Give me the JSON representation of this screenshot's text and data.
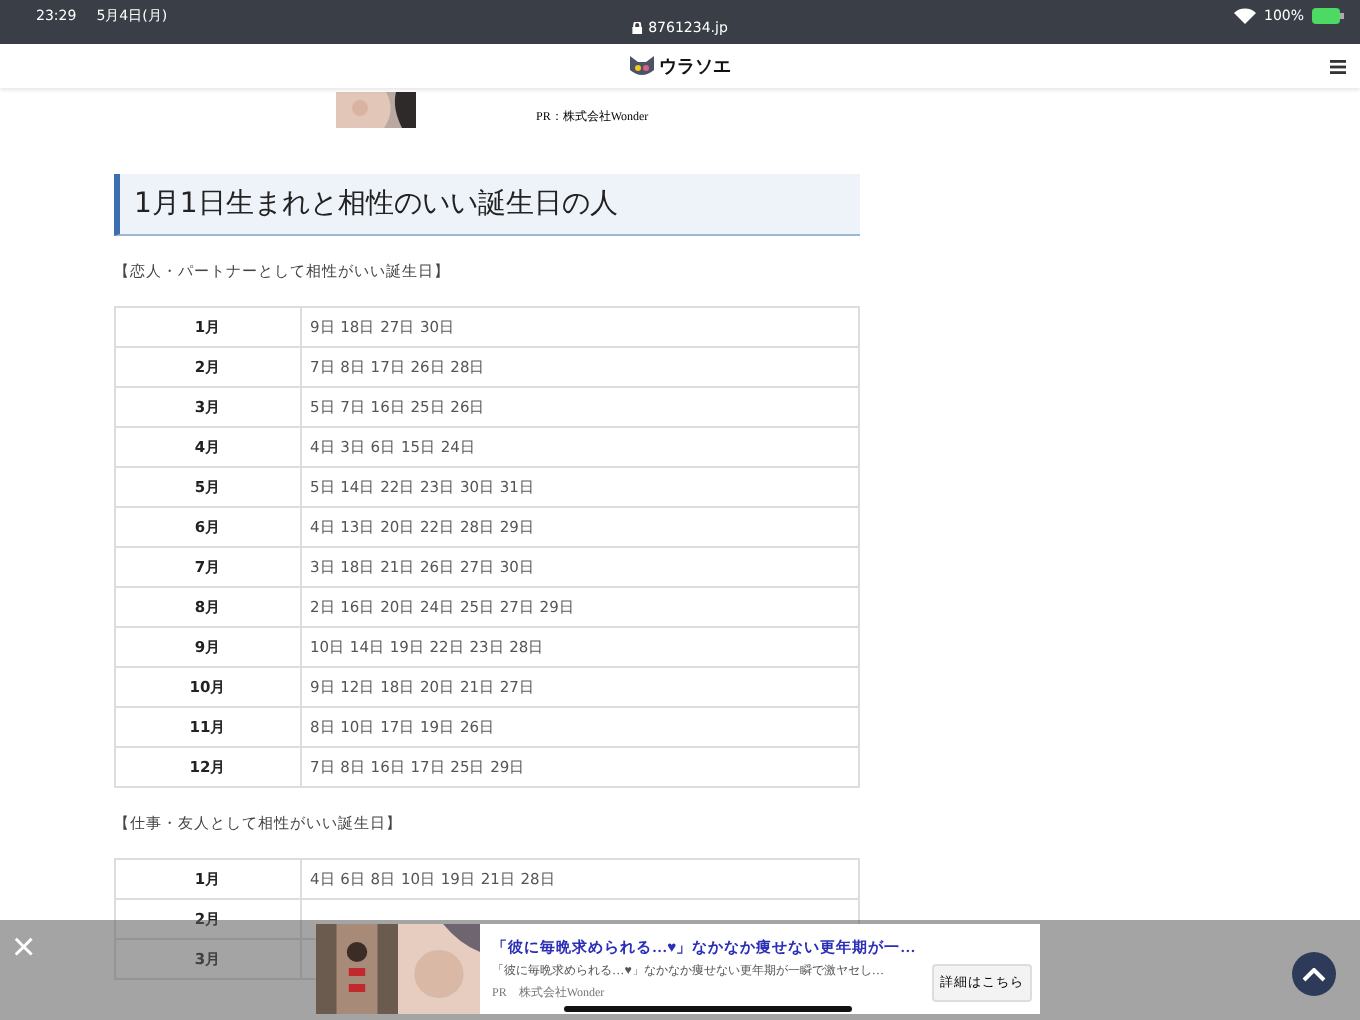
{
  "status_bar": {
    "time": "23:29",
    "date": "5月4日(月)",
    "battery": "100%"
  },
  "address_bar": {
    "url": "8761234.jp"
  },
  "site_header": {
    "logo_text": "ウラソエ"
  },
  "top_ad": {
    "advertiser": "PR：株式会社Wonder"
  },
  "heading": "1月1日生まれと相性のいい誕生日の人",
  "sections": [
    {
      "caption": "【恋人・パートナーとして相性がいい誕生日】",
      "rows": [
        {
          "month": "1月",
          "days": "9日 18日 27日 30日"
        },
        {
          "month": "2月",
          "days": "7日 8日 17日 26日 28日"
        },
        {
          "month": "3月",
          "days": "5日 7日 16日 25日 26日"
        },
        {
          "month": "4月",
          "days": "4日 3日 6日 15日 24日"
        },
        {
          "month": "5月",
          "days": "5日 14日 22日 23日 30日 31日"
        },
        {
          "month": "6月",
          "days": "4日 13日 20日 22日 28日 29日"
        },
        {
          "month": "7月",
          "days": "3日 18日 21日 26日 27日 30日"
        },
        {
          "month": "8月",
          "days": "2日 16日 20日 24日 25日 27日 29日"
        },
        {
          "month": "9月",
          "days": "10日 14日 19日 22日 23日 28日"
        },
        {
          "month": "10月",
          "days": "9日 12日 18日 20日 21日 27日"
        },
        {
          "month": "11月",
          "days": "8日 10日 17日 19日 26日"
        },
        {
          "month": "12月",
          "days": "7日 8日 16日 17日 25日 29日"
        }
      ]
    },
    {
      "caption": "【仕事・友人として相性がいい誕生日】",
      "rows": [
        {
          "month": "1月",
          "days": "4日 6日 8日 10日 19日 21日 28日"
        },
        {
          "month": "2月"
        },
        {
          "month": "3月"
        }
      ]
    }
  ],
  "bottom_ad": {
    "close": "×",
    "title": "「彼に毎晩求められる…♥」なかなか痩せない更年期が一…",
    "description": "「彼に毎晩求められる…♥」なかなか痩せない更年期が一瞬で激ヤセし…",
    "advertiser": "PR　株式会社Wonder",
    "button": "詳細はこちら"
  }
}
